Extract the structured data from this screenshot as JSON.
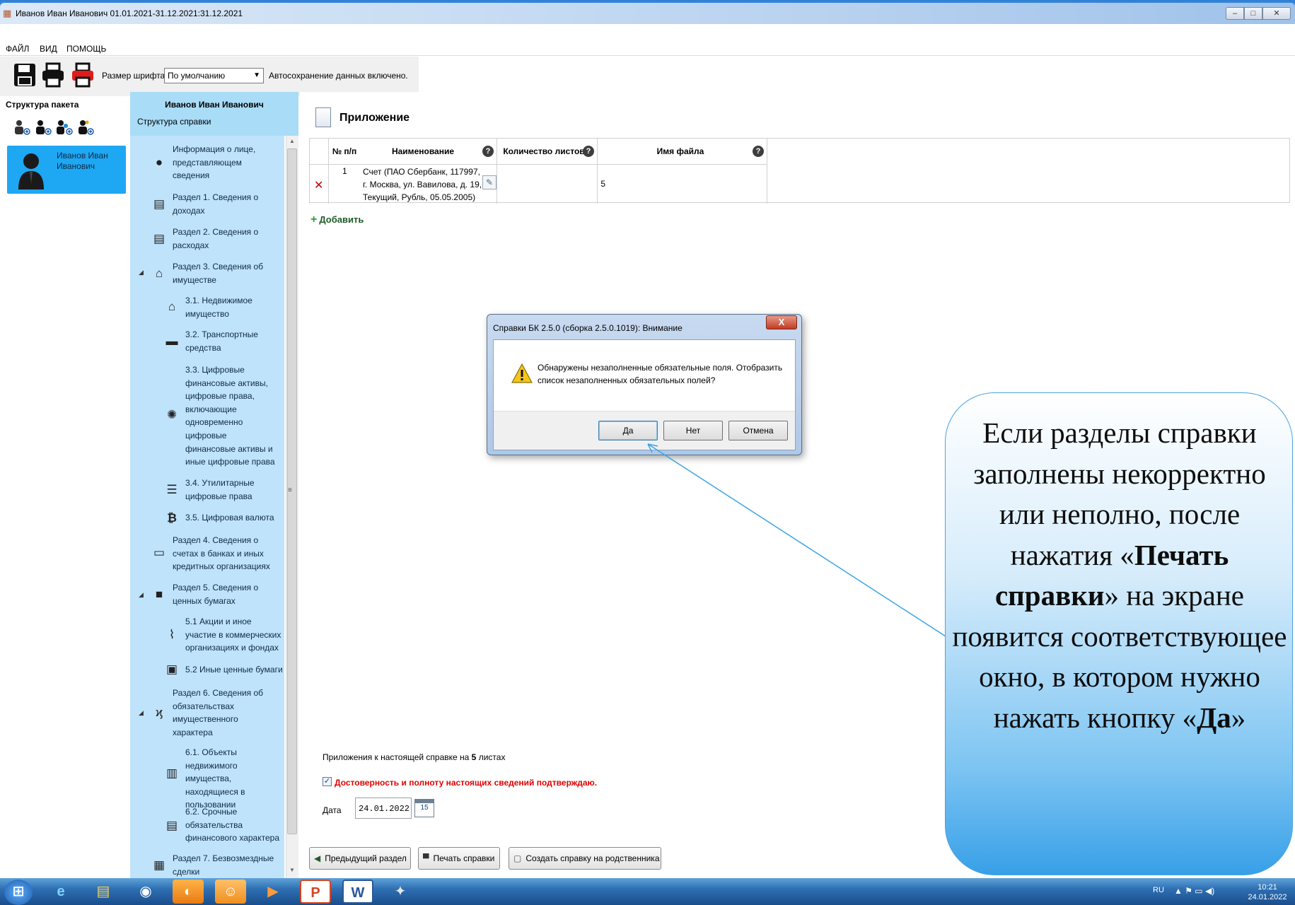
{
  "window": {
    "title": "Иванов Иван Иванович 01.01.2021-31.12.2021:31.12.2021",
    "min_glyph": "–",
    "max_glyph": "□",
    "close_glyph": "✕"
  },
  "menu": {
    "file": "ФАЙЛ",
    "view": "ВИД",
    "help": "ПОМОЩЬ"
  },
  "toolbar": {
    "font_size_label": "Размер шрифта:",
    "font_size_value": "По умолчанию",
    "autosave": "Автосохранение данных включено."
  },
  "package": {
    "header": "Структура пакета",
    "person_name": "Иванов Иван Иванович"
  },
  "structure": {
    "person": "Иванов Иван Иванович",
    "subtitle": "Структура справки",
    "items": [
      {
        "label": "Информация о лице, представляющем сведения",
        "icon": "info-icon"
      },
      {
        "label": "Раздел 1. Сведения о доходах",
        "icon": "income-icon"
      },
      {
        "label": "Раздел 2. Сведения о расходах",
        "icon": "expense-icon"
      },
      {
        "label": "Раздел 3. Сведения об имуществе",
        "icon": "property-icon"
      },
      {
        "label": "3.1. Недвижимое имущество",
        "icon": "house-icon"
      },
      {
        "label": "3.2. Транспортные средства",
        "icon": "car-icon"
      },
      {
        "label": "3.3. Цифровые финансовые активы, цифровые права, включающие одновременно цифровые финансовые активы и иные цифровые права",
        "icon": "digital-asset-icon"
      },
      {
        "label": "3.4. Утилитарные цифровые права",
        "icon": "utility-rights-icon"
      },
      {
        "label": "3.5. Цифровая валюта",
        "icon": "bitcoin-icon"
      },
      {
        "label": "Раздел 4. Сведения о счетах в банках и иных кредитных организациях",
        "icon": "bank-card-icon"
      },
      {
        "label": "Раздел 5. Сведения о ценных бумагах",
        "icon": "briefcase-icon"
      },
      {
        "label": "5.1 Акции и иное участие в коммерческих организациях и фондах",
        "icon": "chart-icon"
      },
      {
        "label": "5.2 Иные ценные бумаги",
        "icon": "securities-icon"
      },
      {
        "label": "Раздел 6. Сведения об обязательствах имущественного характера",
        "icon": "obligation-icon"
      },
      {
        "label": "6.1. Объекты недвижимого имущества, находящиеся в пользовании",
        "icon": "building-icon"
      },
      {
        "label": "6.2. Срочные обязательства финансового характера",
        "icon": "document-pen-icon"
      },
      {
        "label": "Раздел 7. Безвозмездные сделки",
        "icon": "gift-icon"
      }
    ]
  },
  "main": {
    "title": "Приложение",
    "table": {
      "headers": [
        "№ п/п",
        "Наименование",
        "Количество листов",
        "Имя файла"
      ],
      "rows": [
        {
          "num": "1",
          "name": "Счет (ПАО Сбербанк, 117997, г. Москва, ул. Вавилова, д. 19, Текущий, Рубль, 05.05.2005)",
          "count": "5",
          "file": ""
        }
      ]
    },
    "add_label": "Добавить",
    "attach_prefix": "Приложения к настоящей справке на",
    "attach_count": "5",
    "attach_suffix": "листах",
    "confirm_text": "Достоверность и полноту настоящих сведений подтверждаю.",
    "date_label": "Дата",
    "date_value": "24.01.2022",
    "calendar_day": "15",
    "btn_prev": "Предыдущий раздел",
    "btn_print": "Печать справки",
    "btn_relative": "Создать справку на родственника"
  },
  "dialog": {
    "title": "Справки БК 2.5.0 (сборка 2.5.0.1019): Внимание",
    "text": "Обнаружены незаполненные обязательные поля. Отобразить список незаполненных обязательных полей?",
    "yes": "Да",
    "no": "Нет",
    "cancel": "Отмена",
    "close_glyph": "X"
  },
  "callout": {
    "part1": "Если разделы справки заполнены некорректно или неполно, после нажатия «",
    "bold1": "Печать справки",
    "part2": "» на экране появится соответствующее окно, в котором нужно нажать кнопку «",
    "bold2": "Да",
    "part3": "»"
  },
  "taskbar": {
    "lang": "RU",
    "time": "10:21",
    "date": "24.01.2022"
  },
  "colors": {
    "accent": "#1ea7f2",
    "struct_bg": "#bfe3fb",
    "confirm_red": "#e00000",
    "dialog_close": "#c23b22"
  }
}
